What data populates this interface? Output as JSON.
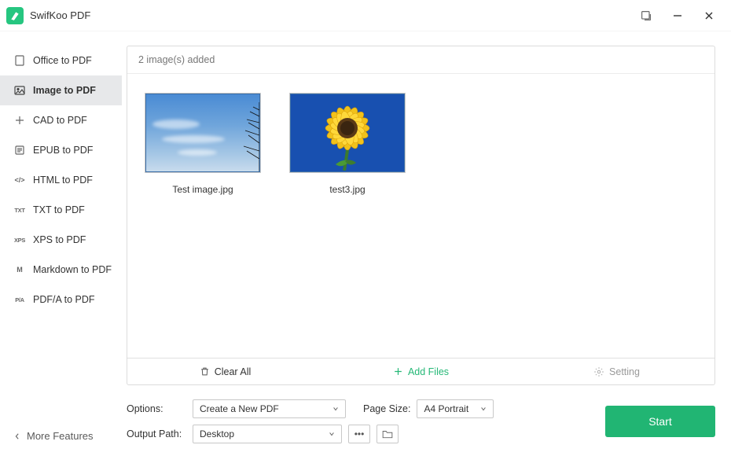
{
  "app": {
    "title": "SwifKoo PDF"
  },
  "sidebar": {
    "items": [
      {
        "label": "Office to PDF",
        "icon": "O"
      },
      {
        "label": "Image to PDF",
        "icon": "img"
      },
      {
        "label": "CAD to PDF",
        "icon": "cad"
      },
      {
        "label": "EPUB to PDF",
        "icon": "E"
      },
      {
        "label": "HTML to PDF",
        "icon": "</>"
      },
      {
        "label": "TXT to PDF",
        "icon": "TXT"
      },
      {
        "label": "XPS to PDF",
        "icon": "XPS"
      },
      {
        "label": "Markdown to PDF",
        "icon": "M"
      },
      {
        "label": "PDF/A to PDF",
        "icon": "P/A"
      }
    ],
    "more": "More Features"
  },
  "content": {
    "header": "2 image(s) added",
    "files": [
      {
        "name": "Test image.jpg"
      },
      {
        "name": "test3.jpg"
      }
    ],
    "actions": {
      "clear": "Clear All",
      "add": "Add Files",
      "setting": "Setting"
    }
  },
  "options": {
    "label": "Options:",
    "create_select": "Create a New PDF",
    "page_size_label": "Page Size:",
    "page_size_value": "A4 Portrait",
    "output_label": "Output Path:",
    "output_value": "Desktop"
  },
  "start": "Start"
}
